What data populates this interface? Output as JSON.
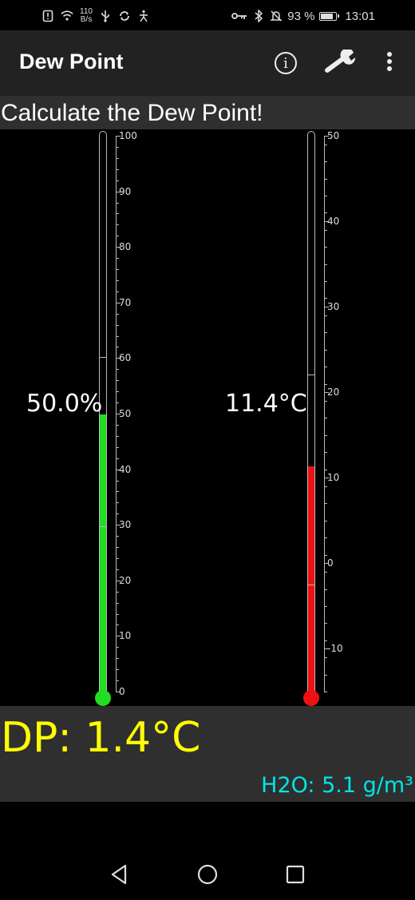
{
  "status_bar": {
    "net_speed_value": "110",
    "net_speed_unit": "B/s",
    "battery_percent": "93 %",
    "time": "13:01",
    "icons_left": [
      "sim-alert-icon",
      "wifi-icon",
      "usb-icon",
      "sync-icon",
      "accessibility-icon"
    ],
    "icons_right": [
      "vpn-key-icon",
      "bluetooth-icon",
      "mute-icon",
      "battery-icon"
    ]
  },
  "app_bar": {
    "title": "Dew Point",
    "actions": [
      "info-icon",
      "wrench-icon",
      "overflow-menu-icon"
    ]
  },
  "heading": "Calculate the Dew Point!",
  "humidity_gauge": {
    "reading": "50.0%",
    "value": 50,
    "min": 0,
    "max": 100,
    "fill_color": "#22dd22",
    "tick_labels": [
      "100",
      "90",
      "80",
      "70",
      "60",
      "50",
      "40",
      "30",
      "20",
      "10",
      "0"
    ]
  },
  "temperature_gauge": {
    "reading": "11.4°C",
    "value": 11.4,
    "min": -15,
    "max": 50,
    "fill_color": "#ee1111",
    "tick_labels": [
      "50",
      "40",
      "30",
      "20",
      "10",
      "0",
      "-10"
    ]
  },
  "result": {
    "dew_point": "DP: 1.4°C",
    "dew_point_color": "#ffff00",
    "water_content": "H2O: 5.1 g/m³",
    "water_content_color": "#00e5e5"
  },
  "nav_bar": {
    "buttons": [
      "back-icon",
      "home-icon",
      "recents-icon"
    ]
  }
}
